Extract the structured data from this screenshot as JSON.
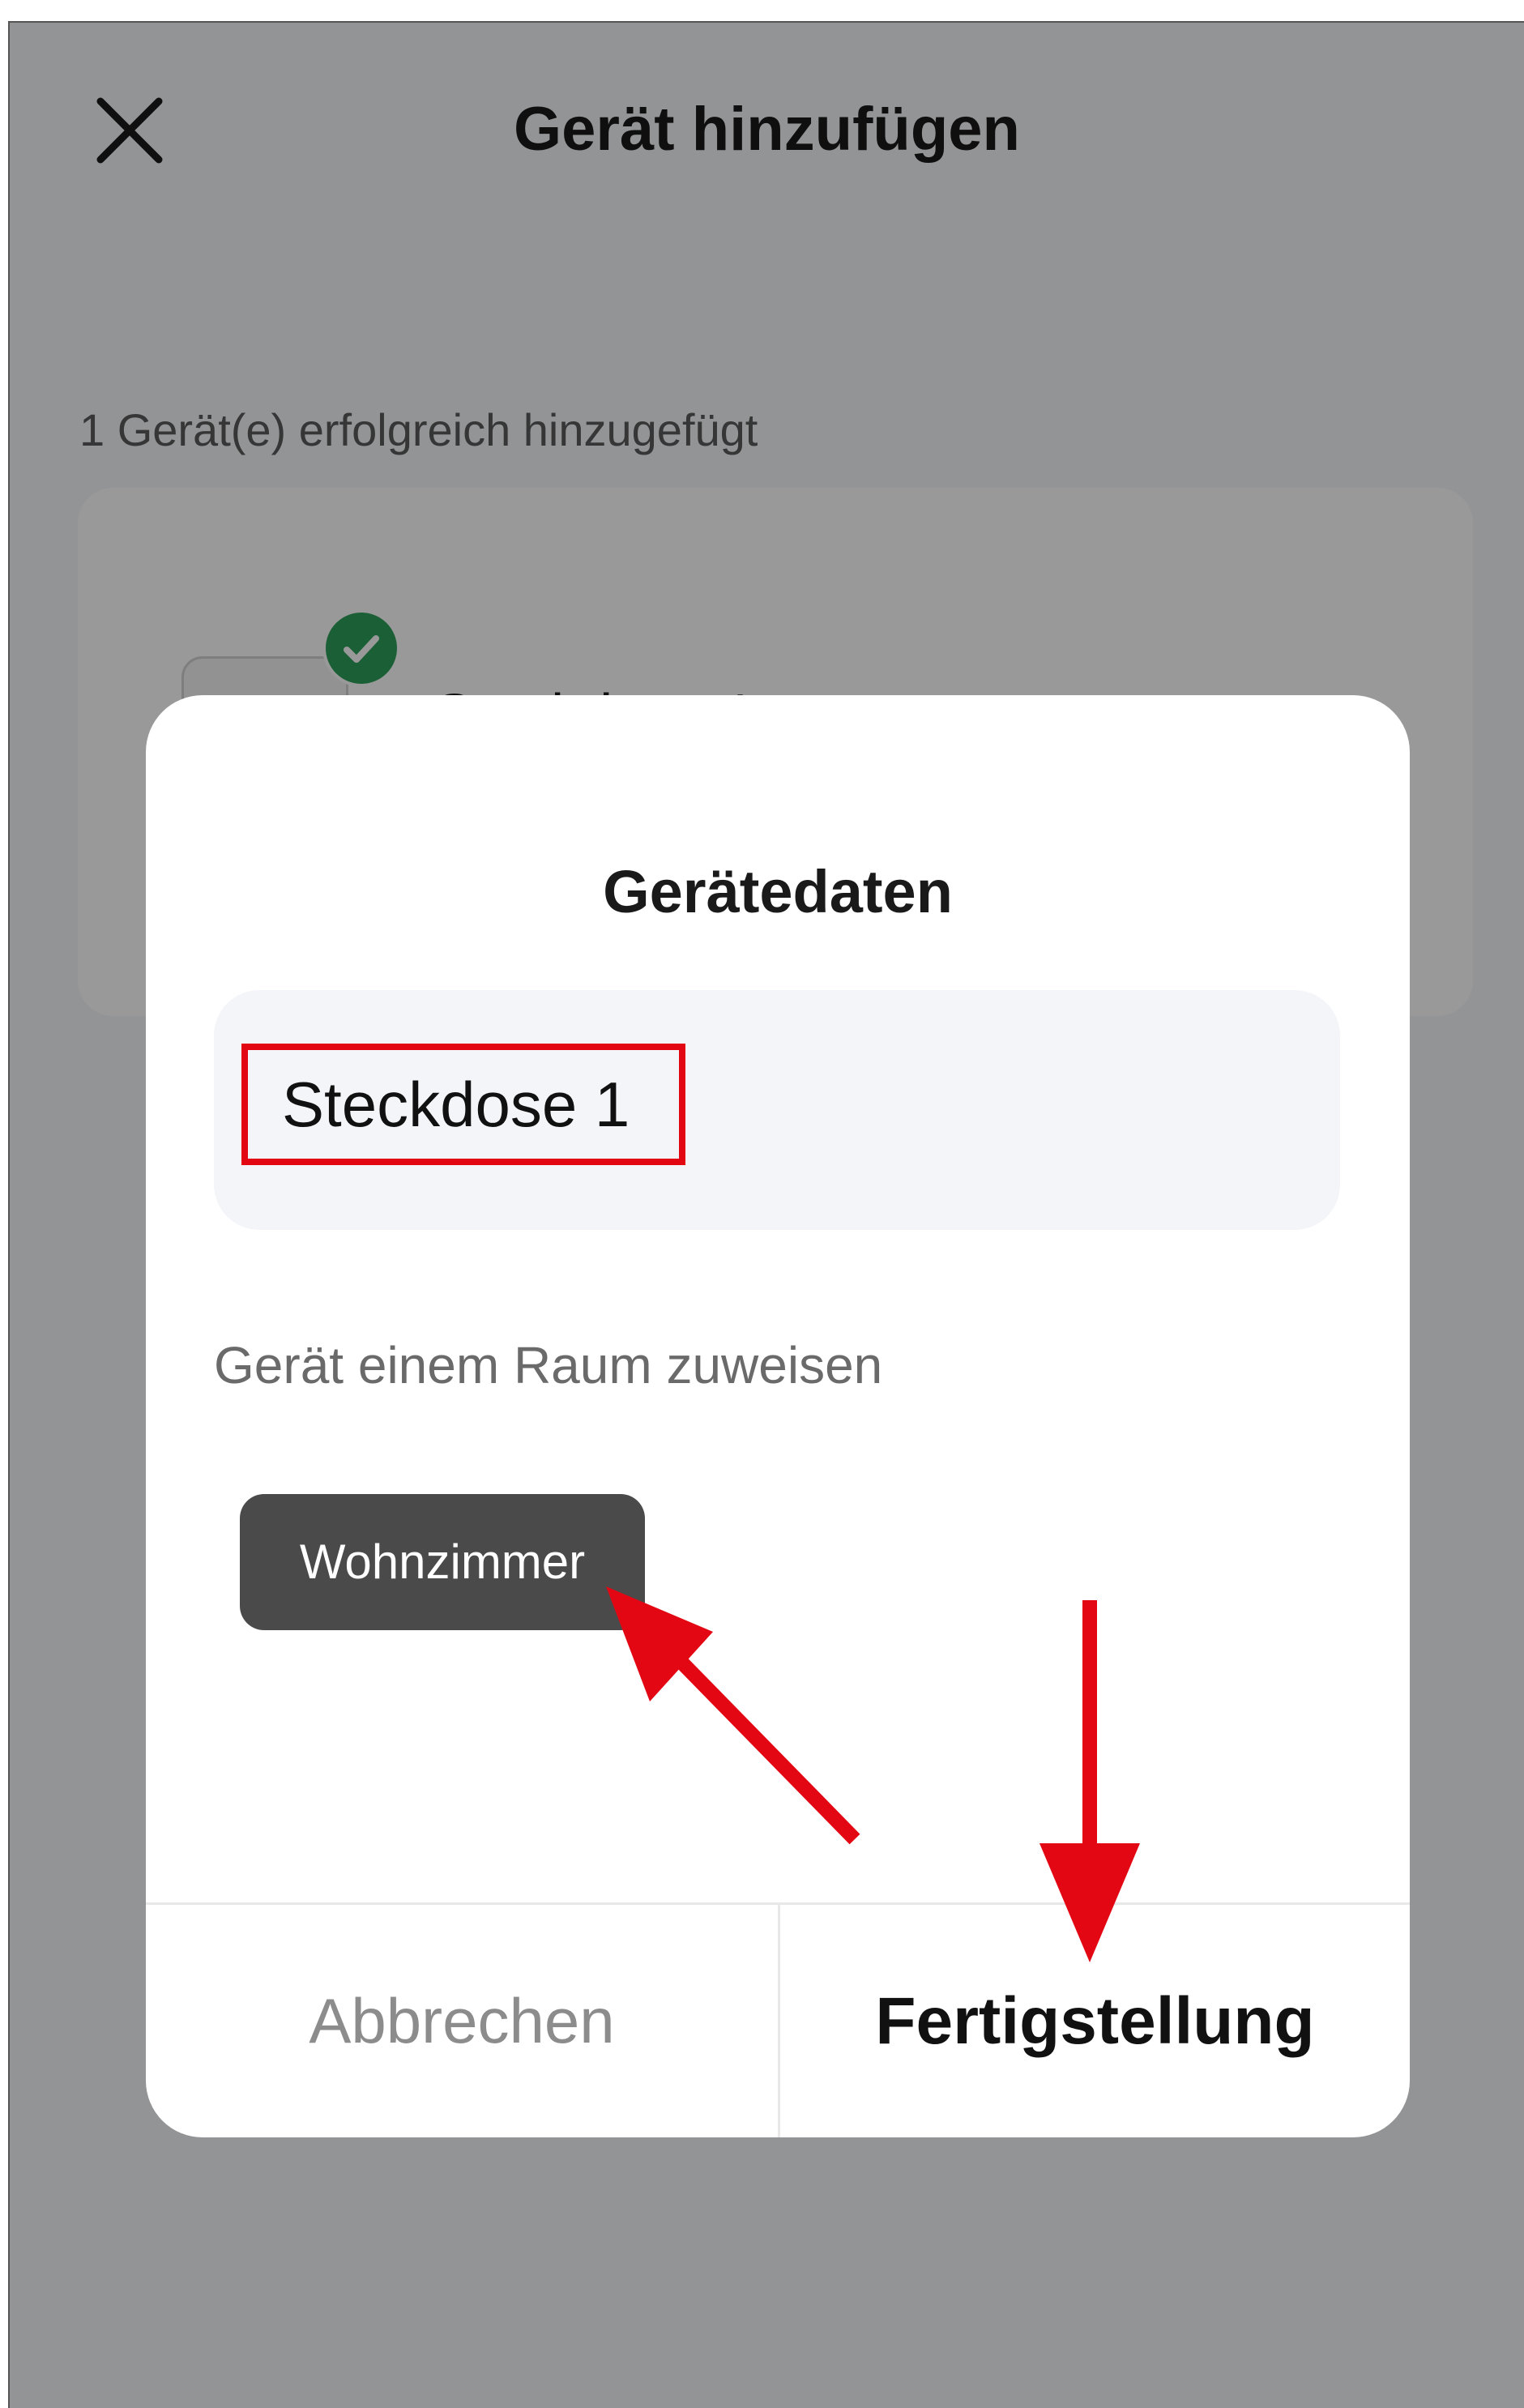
{
  "header": {
    "title": "Gerät hinzufügen",
    "close_icon": "close-icon"
  },
  "background": {
    "success_text": "1 Gerät(e) erfolgreich hinzugefügt",
    "device_card": {
      "device_name": "Steckdose 1",
      "status_icon": "check-icon"
    }
  },
  "dialog": {
    "title": "Gerätedaten",
    "name_field": {
      "value": "Steckdose 1"
    },
    "room_label": "Gerät einem Raum zuweisen",
    "room_chip": "Wohnzimmer",
    "cancel_label": "Abbrechen",
    "finish_label": "Fertigstellung"
  },
  "colors": {
    "accent_red": "#e30613",
    "success_green": "#2e9e5b",
    "chip_dark": "#4a4a4a"
  }
}
